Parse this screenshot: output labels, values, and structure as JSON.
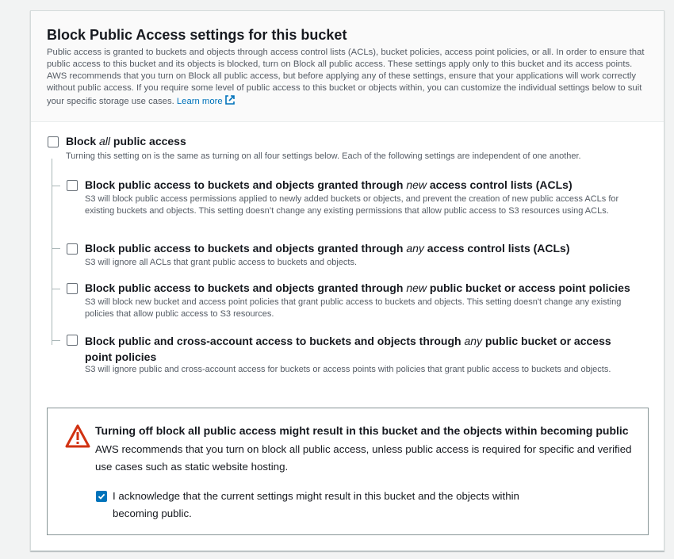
{
  "panel": {
    "title": "Block Public Access settings for this bucket",
    "description": "Public access is granted to buckets and objects through access control lists (ACLs), bucket policies, access point policies, or all. In order to ensure that public access to this bucket and its objects is blocked, turn on Block all public access. These settings apply only to this bucket and its access points. AWS recommends that you turn on Block all public access, but before applying any of these settings, ensure that your applications will work correctly without public access. If you require some level of public access to this bucket or objects within, you can customize the individual settings below to suit your specific storage use cases.",
    "learn_more": "Learn more"
  },
  "block_all": {
    "label_pre": "Block ",
    "label_em": "all",
    "label_post": " public access",
    "description": "Turning this setting on is the same as turning on all four settings below. Each of the following settings are independent of one another.",
    "checked": false
  },
  "settings": [
    {
      "label_pre": "Block public access to buckets and objects granted through ",
      "label_em": "new",
      "label_post": " access control lists (ACLs)",
      "description": "S3 will block public access permissions applied to newly added buckets or objects, and prevent the creation of new public access ACLs for existing buckets and objects. This setting doesn’t change any existing permissions that allow public access to S3 resources using ACLs.",
      "checked": false
    },
    {
      "label_pre": "Block public access to buckets and objects granted through ",
      "label_em": "any",
      "label_post": " access control lists (ACLs)",
      "description": "S3 will ignore all ACLs that grant public access to buckets and objects.",
      "checked": false
    },
    {
      "label_pre": "Block public access to buckets and objects granted through ",
      "label_em": "new",
      "label_post": " public bucket or access point policies",
      "description": "S3 will block new bucket and access point policies that grant public access to buckets and objects. This setting doesn't change any existing policies that allow public access to S3 resources.",
      "checked": false
    },
    {
      "label_pre": "Block public and cross-account access to buckets and objects through ",
      "label_em": "any",
      "label_post": " public bucket or access point policies",
      "description": "S3 will ignore public and cross-account access for buckets or access points with policies that grant public access to buckets and objects.",
      "checked": false
    }
  ],
  "alert": {
    "icon": "warning-icon",
    "title": "Turning off block all public access might result in this bucket and the objects within becoming public",
    "text": "AWS recommends that you turn on block all public access, unless public access is required for specific and verified use cases such as static website hosting.",
    "acknowledge": "I acknowledge that the current settings might result in this bucket and the objects within becoming public.",
    "acknowledge_checked": true
  },
  "colors": {
    "link": "#0073bb",
    "checkbox_checked": "#0073bb",
    "warning": "#d13212"
  }
}
